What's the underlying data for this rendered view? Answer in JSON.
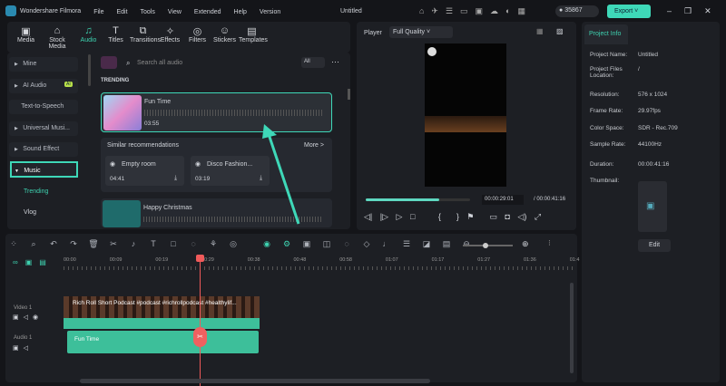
{
  "app": {
    "name": "Wondershare Filmora",
    "project_title": "Untitled",
    "menu": [
      "File",
      "Edit",
      "Tools",
      "View",
      "Extended",
      "Help",
      "Version"
    ],
    "credits": "35867",
    "export_label": "Export"
  },
  "tabs": [
    {
      "label": "Media",
      "icon": "▣"
    },
    {
      "label": "Stock Media",
      "icon": "⌂"
    },
    {
      "label": "Audio",
      "icon": "♫"
    },
    {
      "label": "Titles",
      "icon": "T"
    },
    {
      "label": "Transitions",
      "icon": "⧉"
    },
    {
      "label": "Effects",
      "icon": "✧"
    },
    {
      "label": "Filters",
      "icon": "◎"
    },
    {
      "label": "Stickers",
      "icon": "☺"
    },
    {
      "label": "Templates",
      "icon": "▤"
    }
  ],
  "sidebar": {
    "items": [
      "Mine",
      "AI Audio",
      "Text-to-Speech",
      "Universal Musi...",
      "Sound Effect",
      "Music"
    ],
    "ai_badge": "AI",
    "sub_items": [
      "Trending",
      "Vlog"
    ]
  },
  "audio": {
    "search_placeholder": "Search all audio",
    "filter": "All",
    "section": "TRENDING",
    "featured": {
      "title": "Fun Time",
      "duration": "03:55"
    },
    "similar_title": "Similar recommendations",
    "more": "More >",
    "similar": [
      {
        "title": "Empty room",
        "duration": "04:41"
      },
      {
        "title": "Disco Fashion...",
        "duration": "03:19"
      }
    ],
    "next": {
      "title": "Happy Christmas"
    }
  },
  "player": {
    "label": "Player",
    "quality": "Full Quality",
    "current_time": "00:00:29:01",
    "total_time": "/ 00:00:41:16",
    "progress": 0.7
  },
  "project_info": {
    "tab": "Project Info",
    "rows": [
      {
        "label": "Project Name:",
        "value": "Untitled"
      },
      {
        "label": "Project Files Location:",
        "value": "/"
      },
      {
        "label": "Resolution:",
        "value": "576 x 1024"
      },
      {
        "label": "Frame Rate:",
        "value": "29.97fps"
      },
      {
        "label": "Color Space:",
        "value": "SDR - Rec.709"
      },
      {
        "label": "Sample Rate:",
        "value": "44100Hz"
      },
      {
        "label": "Duration:",
        "value": "00:00:41:16"
      }
    ],
    "thumbnail_label": "Thumbnail:",
    "edit": "Edit"
  },
  "timeline": {
    "ticks": [
      "00:00",
      "00:09",
      "00:19",
      "00:29",
      "00:38",
      "00:48",
      "00:58",
      "01:07",
      "01:17",
      "01:27",
      "01:36",
      "01:4"
    ],
    "video_track": "Video 1",
    "audio_track": "Audio 1",
    "video_clip": "Rich Roll Short Podcast #podcast #richrollpodcast #healthylif...",
    "audio_clip": "Fun Time"
  },
  "colors": {
    "accent": "#3ed2b0",
    "playhead": "#f05a5a",
    "audio_clip": "#3dbf9a"
  }
}
